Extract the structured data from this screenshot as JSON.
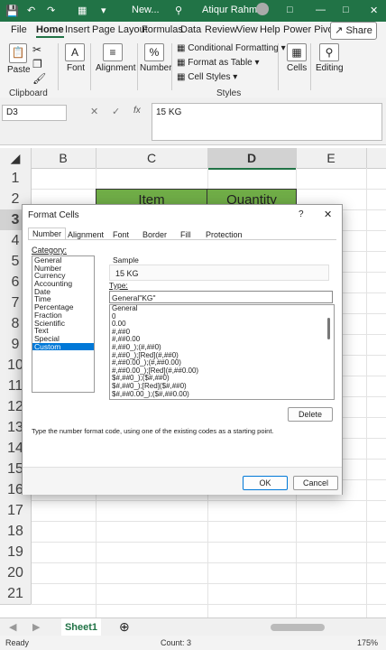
{
  "titlebar": {
    "doc": "New...",
    "user": "Atiqur Rahman"
  },
  "menu": {
    "tabs": [
      "File",
      "Home",
      "Insert",
      "Page Layout",
      "Formulas",
      "Data",
      "Review",
      "View",
      "Help",
      "Power Pivot"
    ],
    "active": "Home",
    "share": "Share"
  },
  "ribbon": {
    "clipboard": {
      "paste": "Paste",
      "group": "Clipboard"
    },
    "font": "Font",
    "alignment": "Alignment",
    "number": "Number",
    "styles": {
      "conditional": "Conditional Formatting",
      "table": "Format as Table",
      "cell_styles": "Cell Styles",
      "group": "Styles"
    },
    "cells": "Cells",
    "editing": "Editing"
  },
  "formula_bar": {
    "name_box": "D3",
    "fx": "fx",
    "value": "15 KG"
  },
  "grid": {
    "columns": [
      "B",
      "C",
      "D",
      "E"
    ],
    "rows": [
      "1",
      "2",
      "3",
      "4",
      "5",
      "6",
      "7",
      "8",
      "9",
      "10",
      "11",
      "12",
      "13",
      "14",
      "15",
      "16",
      "17",
      "18",
      "19",
      "20",
      "21"
    ],
    "headers": {
      "item": "Item",
      "quantity": "Quantity"
    }
  },
  "sheet": {
    "tab": "Sheet1"
  },
  "status": {
    "ready": "Ready",
    "count": "Count: 3",
    "zoom": "175%"
  },
  "dialog": {
    "title": "Format Cells",
    "help": "?",
    "tabs": [
      "Number",
      "Alignment",
      "Font",
      "Border",
      "Fill",
      "Protection"
    ],
    "active_tab": "Number",
    "category_label": "Category:",
    "categories": [
      "General",
      "Number",
      "Currency",
      "Accounting",
      "Date",
      "Time",
      "Percentage",
      "Fraction",
      "Scientific",
      "Text",
      "Special",
      "Custom"
    ],
    "selected_category": "Custom",
    "sample_label": "Sample",
    "sample_value": "15 KG",
    "type_label": "Type:",
    "type_value": "General\"KG\"",
    "type_list": [
      "General",
      "0",
      "0.00",
      "#,##0",
      "#,##0.00",
      "#,##0_);(#,##0)",
      "#,##0_);[Red](#,##0)",
      "#,##0.00_);(#,##0.00)",
      "#,##0.00_);[Red](#,##0.00)",
      "$#,##0_);($#,##0)",
      "$#,##0_);[Red]($#,##0)",
      "$#,##0.00_);($#,##0.00)"
    ],
    "delete": "Delete",
    "hint": "Type the number format code, using one of the existing codes as a starting point.",
    "ok": "OK",
    "cancel": "Cancel"
  }
}
